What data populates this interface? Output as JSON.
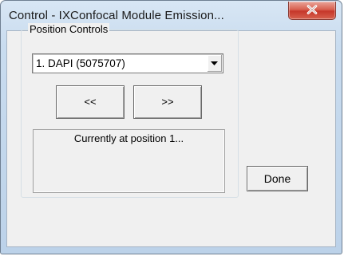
{
  "window": {
    "title": "Control - IXConfocal Module Emission...",
    "close_icon": "close-x-icon",
    "close_color": "#c6372a"
  },
  "position_controls": {
    "group_label": "Position Controls",
    "selected_position": "1. DAPI (5075707)",
    "dropdown_icon": "chevron-down-icon",
    "prev_label": "<<",
    "next_label": ">>",
    "status_text": "Currently at position 1..."
  },
  "footer": {
    "done_label": "Done"
  }
}
